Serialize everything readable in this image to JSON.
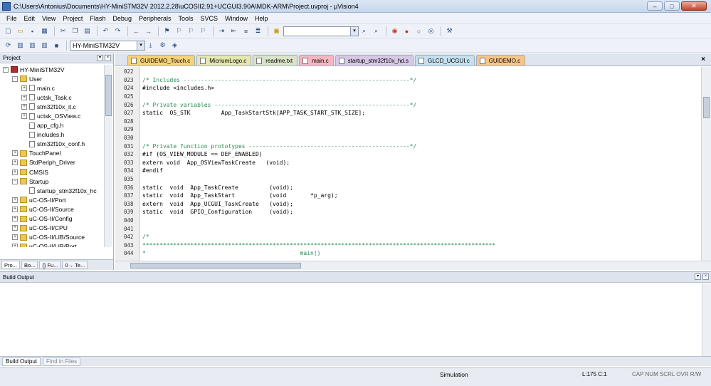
{
  "window": {
    "title": "C:\\Users\\Antonius\\Documents\\HY-MiniSTM32V 2012.2.28\\uCOSII2.91+UCGUI3.90A\\MDK-ARM\\Project.uvproj - µVision4",
    "buttons": {
      "minimize": "–",
      "maximize": "□",
      "close": "✕"
    }
  },
  "menu": [
    "File",
    "Edit",
    "View",
    "Project",
    "Flash",
    "Debug",
    "Peripherals",
    "Tools",
    "SVCS",
    "Window",
    "Help"
  ],
  "toolbar": {
    "find_combo_value": "",
    "target_combo_value": "HY-MiniSTM32V",
    "icons_row1": [
      "new-file-icon",
      "open-icon",
      "save-icon",
      "save-all-icon",
      "cut-icon",
      "copy-icon",
      "paste-icon",
      "undo-icon",
      "redo-icon",
      "nav-back-icon",
      "nav-forward-icon",
      "bookmark-icon",
      "prev-bookmark-icon",
      "next-bookmark-icon",
      "clear-bookmarks-icon",
      "indent-icon",
      "unindent-icon",
      "comment-icon",
      "uncomment-icon",
      "find-in-files-icon",
      "find-icon",
      "incremental-find-icon",
      "debug-icon",
      "breakpoint-icon",
      "disable-breakpoint-icon",
      "kill-breakpoints-icon",
      "configure-icon"
    ],
    "icons_row2": [
      "translate-icon",
      "build-icon",
      "rebuild-icon",
      "batch-build-icon",
      "stop-build-icon",
      "download-icon",
      "target-options-icon",
      "manage-components-icon"
    ]
  },
  "project_panel": {
    "title": "Project",
    "tree": [
      {
        "label": "HY-MiniSTM32V",
        "level": 0,
        "kind": "target",
        "expander": "-"
      },
      {
        "label": "User",
        "level": 1,
        "kind": "folder",
        "expander": "-"
      },
      {
        "label": "main.c",
        "level": 2,
        "kind": "file",
        "expander": "+"
      },
      {
        "label": "uctsk_Task.c",
        "level": 2,
        "kind": "file",
        "expander": "+"
      },
      {
        "label": "stm32f10x_it.c",
        "level": 2,
        "kind": "file",
        "expander": "+"
      },
      {
        "label": "uctsk_OSView.c",
        "level": 2,
        "kind": "file",
        "expander": "+"
      },
      {
        "label": "app_cfg.h",
        "level": 2,
        "kind": "file",
        "expander": ""
      },
      {
        "label": "includes.h",
        "level": 2,
        "kind": "file",
        "expander": ""
      },
      {
        "label": "stm32f10x_conf.h",
        "level": 2,
        "kind": "file",
        "expander": ""
      },
      {
        "label": "TouchPanel",
        "level": 1,
        "kind": "folder",
        "expander": "+"
      },
      {
        "label": "StdPeriph_Driver",
        "level": 1,
        "kind": "folder",
        "expander": "+"
      },
      {
        "label": "CMSIS",
        "level": 1,
        "kind": "folder",
        "expander": "+"
      },
      {
        "label": "Startup",
        "level": 1,
        "kind": "folder",
        "expander": "-"
      },
      {
        "label": "startup_stm32f10x_hc",
        "level": 2,
        "kind": "file",
        "expander": ""
      },
      {
        "label": "uC-OS-II/Port",
        "level": 1,
        "kind": "folder",
        "expander": "+"
      },
      {
        "label": "uC-OS-II/Source",
        "level": 1,
        "kind": "folder",
        "expander": "+"
      },
      {
        "label": "uC-OS-II/Config",
        "level": 1,
        "kind": "folder",
        "expander": "+"
      },
      {
        "label": "uC-OS-II/CPU",
        "level": 1,
        "kind": "folder",
        "expander": "+"
      },
      {
        "label": "uC-OS-II/LIB/Source",
        "level": 1,
        "kind": "folder",
        "expander": "+"
      },
      {
        "label": "uC-OS-II/LIB/Port",
        "level": 1,
        "kind": "folder",
        "expander": "+"
      }
    ],
    "tabs": [
      "Pro...",
      "Bo...",
      "{} Fu...",
      "0→ Te..."
    ]
  },
  "editor": {
    "tabs": [
      {
        "label": "GUIDEMO_Touch.c",
        "color": "#f6d27a"
      },
      {
        "label": "MicriumLogo.c",
        "color": "#e6e6b0"
      },
      {
        "label": "readme.txt",
        "color": "#d9e3c8"
      },
      {
        "label": "main.c",
        "color": "#f5b5c2"
      },
      {
        "label": "startup_stm32f10x_hd.s",
        "color": "#d7c8e6"
      },
      {
        "label": "GLCD_UCGUI.c",
        "color": "#c6e0ef"
      },
      {
        "label": "GUIDEMO.c",
        "color": "#f6c58a"
      }
    ],
    "lines": [
      {
        "num": "022",
        "text": "",
        "comment": false
      },
      {
        "num": "023",
        "text": "/* Includes ------------------------------------------------------------------*/",
        "comment": true
      },
      {
        "num": "024",
        "text": "#include <includes.h>",
        "comment": false
      },
      {
        "num": "025",
        "text": "",
        "comment": false
      },
      {
        "num": "026",
        "text": "/* Private variables ---------------------------------------------------------*/",
        "comment": true
      },
      {
        "num": "027",
        "text": "static  OS_STK         App_TaskStartStk[APP_TASK_START_STK_SIZE];",
        "comment": false
      },
      {
        "num": "028",
        "text": "",
        "comment": false
      },
      {
        "num": "029",
        "text": "",
        "comment": false
      },
      {
        "num": "030",
        "text": "",
        "comment": false
      },
      {
        "num": "031",
        "text": "/* Private function prototypes -----------------------------------------------*/",
        "comment": true
      },
      {
        "num": "032",
        "text": "#if (OS_VIEW_MODULE == DEF_ENABLED)",
        "comment": false
      },
      {
        "num": "033",
        "text": "extern void  App_OSViewTaskCreate   (void);",
        "comment": false
      },
      {
        "num": "034",
        "text": "#endif",
        "comment": false
      },
      {
        "num": "035",
        "text": "",
        "comment": false
      },
      {
        "num": "036",
        "text": "static  void  App_TaskCreate         (void);",
        "comment": false
      },
      {
        "num": "037",
        "text": "static  void  App_TaskStart          (void       *p_arg);",
        "comment": false
      },
      {
        "num": "038",
        "text": "extern  void  App_UCGUI_TaskCreate   (void);",
        "comment": false
      },
      {
        "num": "039",
        "text": "static  void  GPIO_Configuration     (void);",
        "comment": false
      },
      {
        "num": "040",
        "text": "",
        "comment": false
      },
      {
        "num": "041",
        "text": "",
        "comment": false
      },
      {
        "num": "042",
        "text": "/*",
        "comment": true
      },
      {
        "num": "043",
        "text": "*******************************************************************************************************",
        "comment": true
      },
      {
        "num": "044",
        "text": "*                                             main()",
        "comment": true
      }
    ]
  },
  "build_output": {
    "title": "Build Output",
    "tabs": [
      "Build Output",
      "Find in Files"
    ]
  },
  "status": {
    "mode": "Simulation",
    "position": "L:175 C:1",
    "keys": "CAP  NUM  SCRL  OVR  R/W"
  }
}
